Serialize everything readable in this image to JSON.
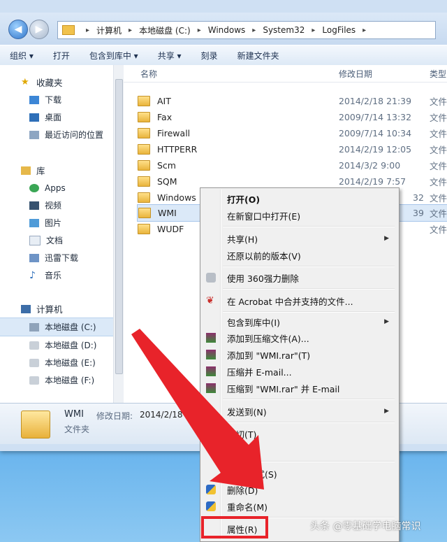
{
  "address": {
    "crumbs": [
      "计算机",
      "本地磁盘 (C:)",
      "Windows",
      "System32",
      "LogFiles"
    ]
  },
  "toolbar": {
    "organize": "组织 ▾",
    "open": "打开",
    "include_library": "包含到库中 ▾",
    "share": "共享 ▾",
    "burn": "刻录",
    "new_folder": "新建文件夹"
  },
  "sidebar": {
    "favorites": "收藏夹",
    "fav_items": [
      "下载",
      "桌面",
      "最近访问的位置"
    ],
    "libraries": "库",
    "lib_items": [
      "Apps",
      "视频",
      "图片",
      "文档",
      "迅雷下载",
      "音乐"
    ],
    "computer": "计算机",
    "drives": [
      "本地磁盘 (C:)",
      "本地磁盘 (D:)",
      "本地磁盘 (E:)",
      "本地磁盘 (F:)"
    ]
  },
  "columns": {
    "name": "名称",
    "date": "修改日期",
    "type": "类型"
  },
  "files": [
    {
      "name": "AIT",
      "date": "2014/2/18 21:39",
      "type": "文件"
    },
    {
      "name": "Fax",
      "date": "2009/7/14 13:32",
      "type": "文件"
    },
    {
      "name": "Firewall",
      "date": "2009/7/14 10:34",
      "type": "文件"
    },
    {
      "name": "HTTPERR",
      "date": "2014/2/19 12:05",
      "type": "文件"
    },
    {
      "name": "Scm",
      "date": "2014/3/2 9:00",
      "type": "文件"
    },
    {
      "name": "SQM",
      "date": "2014/2/19 7:57",
      "type": "文件"
    },
    {
      "name": "Windows",
      "date": "32",
      "type": "文件"
    },
    {
      "name": "WMI",
      "date": "39",
      "type": "文件"
    },
    {
      "name": "WUDF",
      "date": "",
      "type": "文件"
    }
  ],
  "details": {
    "name": "WMI",
    "date_label": "修改日期:",
    "date_value": "2014/2/18 21",
    "type": "文件夹"
  },
  "menu": {
    "open": "打开(O)",
    "open_new": "在新窗口中打开(E)",
    "share": "共享(H)",
    "restore": "还原以前的版本(V)",
    "shred360": "使用 360强力删除",
    "acrobat": "在 Acrobat 中合并支持的文件...",
    "include_lib": "包含到库中(I)",
    "add_archive": "添加到压缩文件(A)...",
    "add_rar": "添加到 \"WMI.rar\"(T)",
    "zip_email": "压缩并 E-mail...",
    "zip_rar_email": "压缩到 \"WMI.rar\" 并 E-mail",
    "send_to": "发送到(N)",
    "cut": "剪切(T)",
    "copy": "(C)",
    "shortcut": "创建  方式(S)",
    "delete": "删除(D)",
    "rename": "重命名(M)",
    "properties": "属性(R)"
  },
  "watermark": "头条 @零基础学电脑常识",
  "colors": {
    "highlight_red": "#e8232a",
    "selection": "#dbe9f8"
  }
}
